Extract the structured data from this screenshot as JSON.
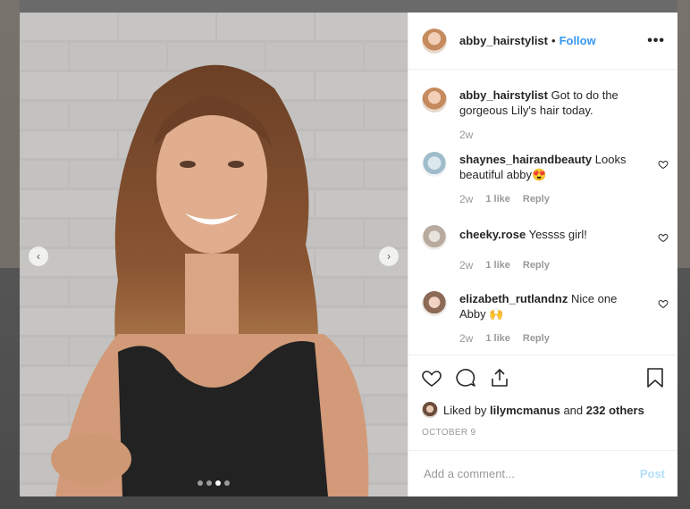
{
  "post": {
    "username": "abby_hairstylist",
    "separator": "•",
    "follow_label": "Follow",
    "more_label": "•••"
  },
  "caption": {
    "username": "abby_hairstylist",
    "text": "Got to do the gorgeous Lily's hair today.",
    "time": "2w"
  },
  "comments": [
    {
      "username": "shaynes_hairandbeauty",
      "text": "Looks beautiful abby😍",
      "time": "2w",
      "likes": "1 like",
      "reply": "Reply"
    },
    {
      "username": "cheeky.rose",
      "text": "Yessss girl!",
      "time": "2w",
      "likes": "1 like",
      "reply": "Reply"
    },
    {
      "username": "elizabeth_rutlandnz",
      "text": "Nice one Abby 🙌",
      "time": "2w",
      "likes": "1 like",
      "reply": "Reply"
    }
  ],
  "likes": {
    "prefix": "Liked by",
    "user": "lilymcmanus",
    "conj": "and",
    "others": "232 others"
  },
  "date": "OCTOBER 9",
  "add_comment": {
    "placeholder": "Add a comment...",
    "post_label": "Post"
  },
  "carousel": {
    "prev": "‹",
    "next": "›",
    "slide_count": 4,
    "current_slide": 3
  },
  "colors": {
    "link": "#3897f0",
    "post_disabled": "#b2dffc",
    "muted": "#999999"
  }
}
